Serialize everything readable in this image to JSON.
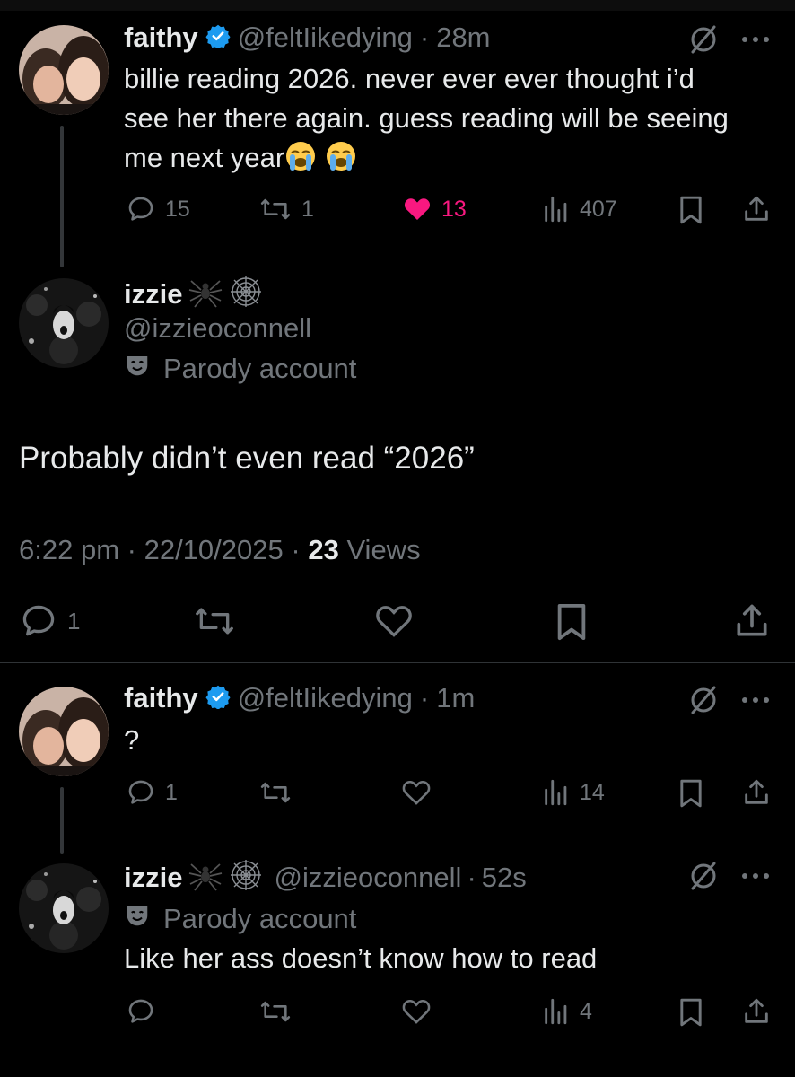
{
  "tweet1": {
    "name": "faithy",
    "handle": "@feltIikedying",
    "sep": "·",
    "time": "28m",
    "text_line1": "billie reading 2026. never ever ever thought i’d",
    "text_line2": "see her there again. guess reading will be seeing",
    "text_line3": "me next year",
    "replies": "15",
    "reposts": "1",
    "likes": "13",
    "views": "407"
  },
  "main": {
    "name": "izzie",
    "handle": "@izzieoconnell",
    "parody_label": "Parody account",
    "text": "Probably didn’t even read “2026”",
    "time": "6:22 pm",
    "sep1": "·",
    "date": "22/10/2025",
    "sep2": "·",
    "views_count": "23",
    "views_label": "Views",
    "replies": "1"
  },
  "tweet3": {
    "name": "faithy",
    "handle": "@feltIikedying",
    "sep": "·",
    "time": "1m",
    "text": "?",
    "replies": "1",
    "views": "14"
  },
  "tweet4": {
    "name": "izzie",
    "handle": "@izzieoconnell",
    "sep": "·",
    "time": "52s",
    "parody_label": "Parody account",
    "text": "Like her ass doesn’t know how to read",
    "views": "4"
  },
  "icons": {
    "verified": "verified-badge-icon",
    "spider": "spider-icon",
    "web": "spider-web-icon",
    "parody": "parody-mask-icon",
    "grok": "grok-icon",
    "more": "more-icon",
    "reply": "reply-icon",
    "repost": "repost-icon",
    "like": "like-icon",
    "views": "views-icon",
    "bookmark": "bookmark-icon",
    "share": "share-icon",
    "emoji": "loudly-crying-face-icon"
  },
  "colors": {
    "background": "#000000",
    "text": "#e7e9ea",
    "secondary": "#71767b",
    "like_active": "#f91880",
    "verified": "#1d9bf0"
  }
}
